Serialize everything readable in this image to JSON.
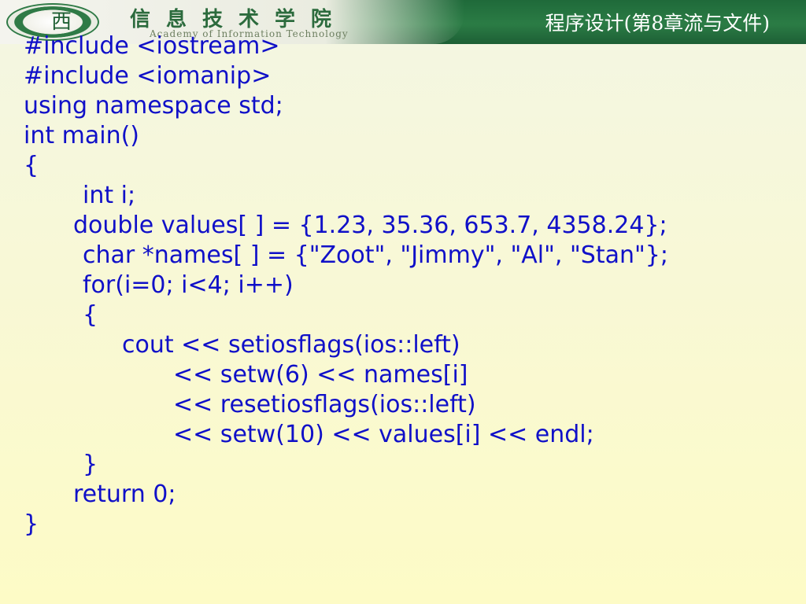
{
  "header": {
    "logo_glyph": "西",
    "academy_name": "信息技术学院",
    "academy_subtitle": "Academy of Information Technology",
    "slide_title": "程序设计(第8章流与文件)"
  },
  "code_lines": [
    {
      "text": "#include <iostream>",
      "indent": 0
    },
    {
      "text": "#include <iomanip>",
      "indent": 0
    },
    {
      "text": "using namespace std;",
      "indent": 0
    },
    {
      "text": "int main()",
      "indent": 0
    },
    {
      "text": "{",
      "indent": 0
    },
    {
      "text": "int i;",
      "indent": 75
    },
    {
      "text": "double values[ ] = {1.23, 35.36, 653.7, 4358.24};",
      "indent": 63
    },
    {
      "text": "char *names[ ] = {\"Zoot\", \"Jimmy\", \"Al\", \"Stan\"};",
      "indent": 75
    },
    {
      "text": "for(i=0; i<4; i++)",
      "indent": 75
    },
    {
      "text": "{",
      "indent": 75
    },
    {
      "text": "cout << setiosflags(ios::left)",
      "indent": 125
    },
    {
      "text": "<< setw(6) << names[i]",
      "indent": 190
    },
    {
      "text": "<< resetiosflags(ios::left)",
      "indent": 190
    },
    {
      "text": "<< setw(10) << values[i] << endl;",
      "indent": 190
    },
    {
      "text": "}",
      "indent": 75
    },
    {
      "text": "return 0;",
      "indent": 63
    },
    {
      "text": "}",
      "indent": 0
    }
  ]
}
